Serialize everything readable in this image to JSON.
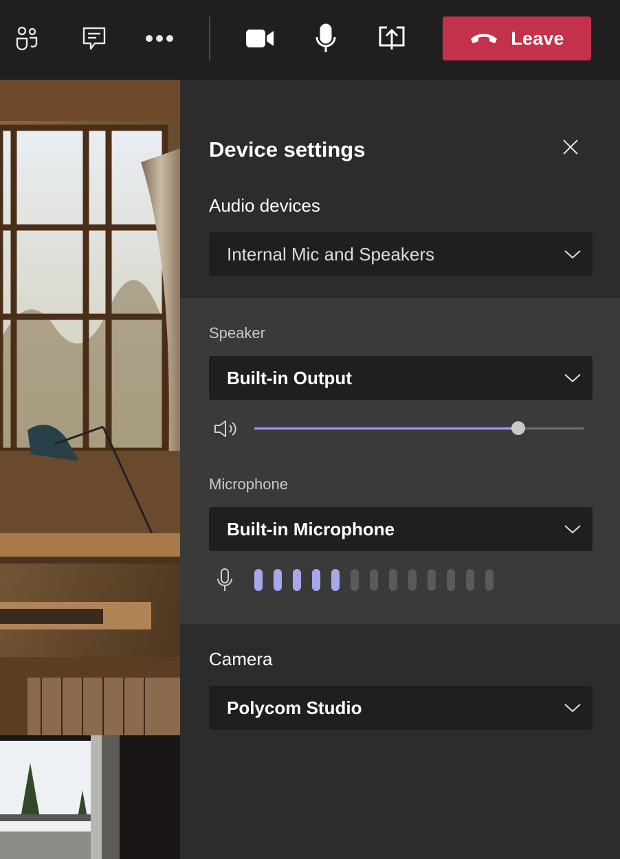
{
  "toolbar": {
    "buttons": [
      {
        "name": "participants",
        "icon": "people-icon"
      },
      {
        "name": "chat",
        "icon": "chat-icon"
      },
      {
        "name": "more",
        "icon": "more-icon"
      },
      {
        "name": "camera",
        "icon": "camera-icon"
      },
      {
        "name": "microphone",
        "icon": "microphone-icon"
      },
      {
        "name": "share",
        "icon": "share-icon"
      }
    ],
    "leave_label": "Leave",
    "leave_color": "#c4314b"
  },
  "panel": {
    "title": "Device settings",
    "audio": {
      "label": "Audio devices",
      "selected": "Internal Mic and Speakers"
    },
    "speaker": {
      "label": "Speaker",
      "selected": "Built-in Output",
      "volume_fraction": 0.8
    },
    "microphone": {
      "label": "Microphone",
      "selected": "Built-in Microphone",
      "level_bars_total": 13,
      "level_bars_active": 5
    },
    "camera": {
      "label": "Camera",
      "selected": "Polycom Studio"
    }
  },
  "colors": {
    "accent": "#9ea2ff",
    "panel_bg": "#2d2c2c",
    "toolbar_bg": "#1f1f1f"
  }
}
